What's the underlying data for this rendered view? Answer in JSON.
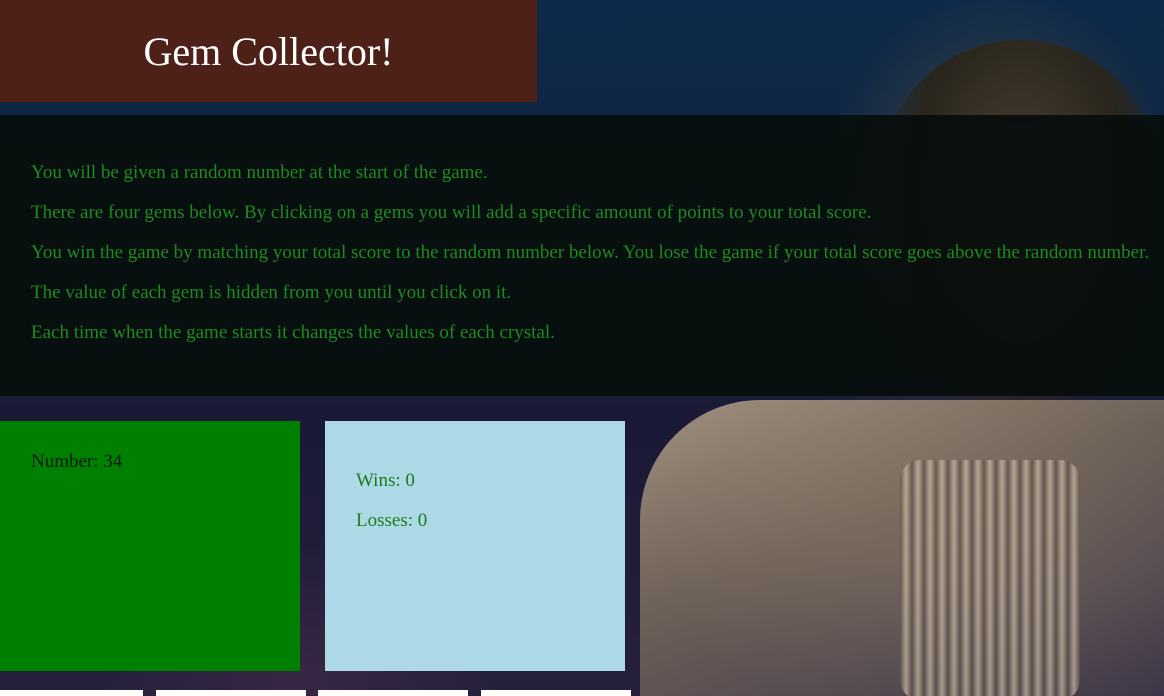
{
  "header": {
    "title": "Gem Collector!"
  },
  "instructions": [
    "You will be given a random number at the start of the game.",
    "There are four gems below. By clicking on a gems you will add a specific amount of points to your total score.",
    "You win the game by matching your total score to the random number below. You lose the game if your total score goes above the random number.",
    "The value of each gem is hidden from you until you click on it.",
    "Each time when the game starts it changes the values of each crystal."
  ],
  "target": {
    "label": "Number: 34"
  },
  "scoreboard": {
    "wins": "Wins: 0",
    "losses": "Losses: 0"
  },
  "gems": [
    "gem-1",
    "gem-2",
    "gem-3",
    "gem-4"
  ],
  "colors": {
    "header_bg": "#4e2118",
    "number_box_bg": "#008000",
    "score_box_bg": "#add8e6",
    "instruction_text": "#1f8a1f"
  }
}
